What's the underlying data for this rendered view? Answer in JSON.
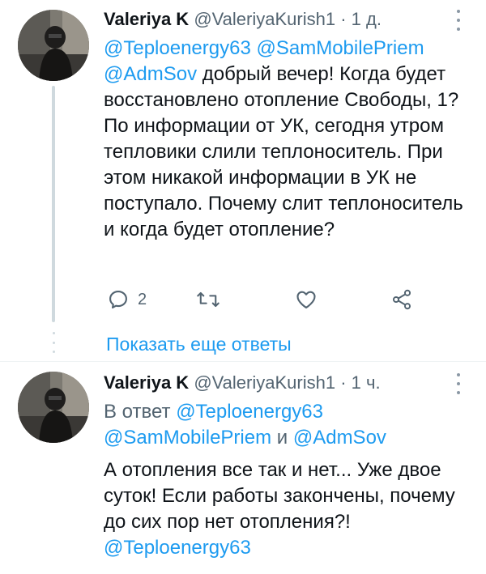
{
  "tweet1": {
    "name": "Valeriya K",
    "handle": "@ValeriyaKurish1",
    "dot": "·",
    "time": "1 д.",
    "mention1": "@Teploenergy63",
    "mention2": "@SamMobilePriem",
    "mention3": "@AdmSov",
    "body": " добрый вечер! Когда будет восстановлено отопление Свободы, 1? По информации от УК, сегодня утром тепловики слили теплоноситель. При этом никакой информации в УК не поступало. Почему слит теплоноситель и когда будет отопление?",
    "reply_count": "2"
  },
  "show_more_label": "Показать еще ответы",
  "tweet2": {
    "name": "Valeriya K",
    "handle": "@ValeriyaKurish1",
    "dot": "·",
    "time": "1 ч.",
    "reply_prefix": "В ответ ",
    "reply_mention1": "@Teploenergy63",
    "reply_mention2": "@SamMobilePriem",
    "reply_and": " и ",
    "reply_mention3": "@AdmSov",
    "body": "А отопления все так и нет... Уже двое суток! Если работы закончены, почему до сих пор нет отопления?!",
    "trailing_mention": "@Teploenergy63"
  },
  "colors": {
    "accent": "#1d9bf0",
    "secondary_text": "#536471",
    "thread_line": "#cfd9de"
  }
}
